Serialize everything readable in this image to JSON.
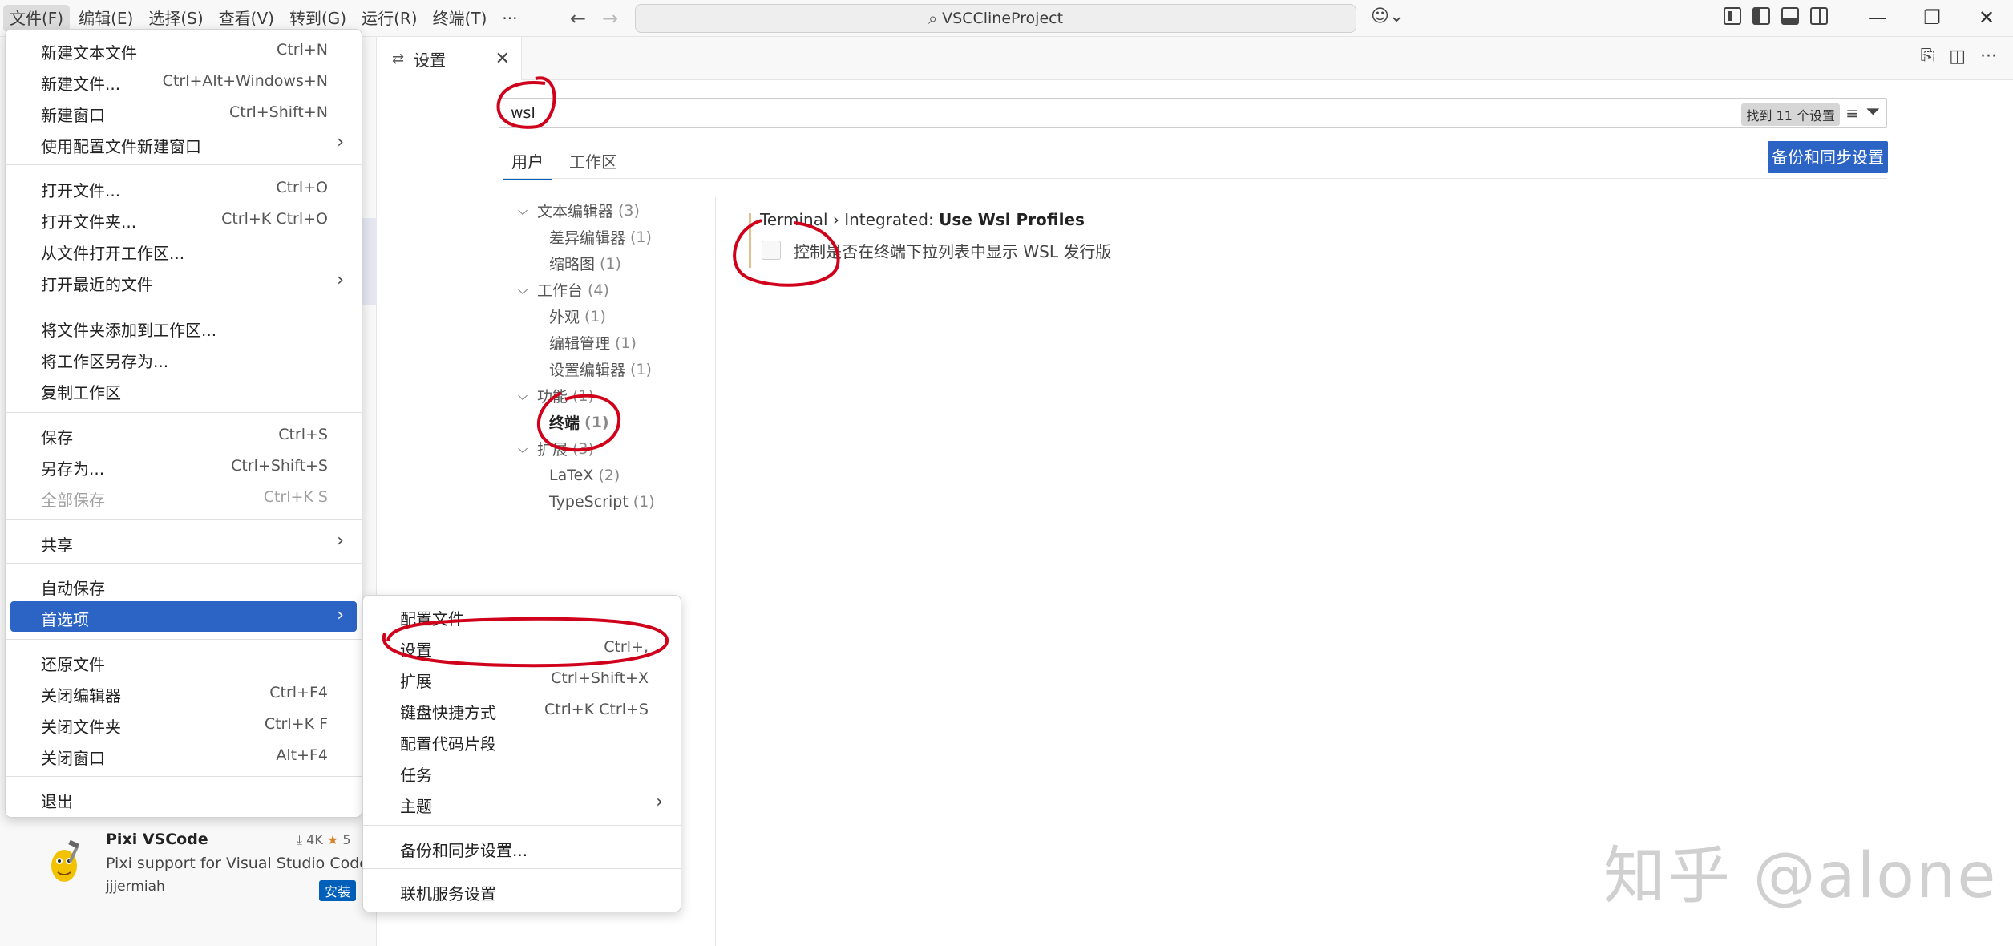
{
  "menubar": {
    "items": [
      "文件(F)",
      "编辑(E)",
      "选择(S)",
      "查看(V)",
      "转到(G)",
      "运行(R)",
      "终端(T)",
      "···"
    ]
  },
  "command_center": {
    "title": "VSCClineProject"
  },
  "editor_tab": {
    "label": "设置"
  },
  "settings": {
    "search_value": "wsl",
    "found_count": "找到 11 个设置",
    "scope_tabs": [
      "用户",
      "工作区"
    ],
    "sync_button": "备份和同步设置",
    "toc": [
      {
        "label": "文本编辑器",
        "count": "(3)"
      },
      {
        "label": "差异编辑器",
        "count": "(1)"
      },
      {
        "label": "缩略图",
        "count": "(1)"
      },
      {
        "label": "工作台",
        "count": "(4)"
      },
      {
        "label": "外观",
        "count": "(1)"
      },
      {
        "label": "编辑管理",
        "count": "(1)"
      },
      {
        "label": "设置编辑器",
        "count": "(1)"
      },
      {
        "label": "功能",
        "count": "(1)"
      },
      {
        "label": "终端",
        "count": "(1)"
      },
      {
        "label": "扩展",
        "count": "(3)"
      },
      {
        "label": "LaTeX",
        "count": "(2)"
      },
      {
        "label": "TypeScript",
        "count": "(1)"
      }
    ],
    "setting_item": {
      "prefix": "Terminal › Integrated: ",
      "name": "Use Wsl Profiles",
      "description": "控制是否在终端下拉列表中显示 WSL 发行版"
    }
  },
  "file_menu": {
    "items": [
      {
        "label": "新建文本文件",
        "shortcut": "Ctrl+N"
      },
      {
        "label": "新建文件...",
        "shortcut": "Ctrl+Alt+Windows+N"
      },
      {
        "label": "新建窗口",
        "shortcut": "Ctrl+Shift+N"
      },
      {
        "label": "使用配置文件新建窗口",
        "shortcut": ""
      },
      {
        "label": "打开文件...",
        "shortcut": "Ctrl+O"
      },
      {
        "label": "打开文件夹...",
        "shortcut": "Ctrl+K Ctrl+O"
      },
      {
        "label": "从文件打开工作区...",
        "shortcut": ""
      },
      {
        "label": "打开最近的文件",
        "shortcut": ""
      },
      {
        "label": "将文件夹添加到工作区...",
        "shortcut": ""
      },
      {
        "label": "将工作区另存为...",
        "shortcut": ""
      },
      {
        "label": "复制工作区",
        "shortcut": ""
      },
      {
        "label": "保存",
        "shortcut": "Ctrl+S"
      },
      {
        "label": "另存为...",
        "shortcut": "Ctrl+Shift+S"
      },
      {
        "label": "全部保存",
        "shortcut": "Ctrl+K S"
      },
      {
        "label": "共享",
        "shortcut": ""
      },
      {
        "label": "自动保存",
        "shortcut": ""
      },
      {
        "label": "首选项",
        "shortcut": ""
      },
      {
        "label": "还原文件",
        "shortcut": ""
      },
      {
        "label": "关闭编辑器",
        "shortcut": "Ctrl+F4"
      },
      {
        "label": "关闭文件夹",
        "shortcut": "Ctrl+K F"
      },
      {
        "label": "关闭窗口",
        "shortcut": "Alt+F4"
      },
      {
        "label": "退出",
        "shortcut": ""
      }
    ]
  },
  "preferences_menu": {
    "items": [
      {
        "label": "配置文件",
        "shortcut": ""
      },
      {
        "label": "设置",
        "shortcut": "Ctrl+,"
      },
      {
        "label": "扩展",
        "shortcut": "Ctrl+Shift+X"
      },
      {
        "label": "键盘快捷方式",
        "shortcut": "Ctrl+K Ctrl+S"
      },
      {
        "label": "配置代码片段",
        "shortcut": ""
      },
      {
        "label": "任务",
        "shortcut": ""
      },
      {
        "label": "主题",
        "shortcut": ""
      },
      {
        "label": "备份和同步设置...",
        "shortcut": ""
      },
      {
        "label": "联机服务设置",
        "shortcut": ""
      }
    ]
  },
  "extension": {
    "name": "Pixi VSCode",
    "downloads": "4K",
    "rating": "5",
    "description": "Pixi support for Visual Studio Code ...",
    "author": "jjjermiah",
    "install_label": "安装"
  },
  "watermark": "知乎 @alone",
  "colors": {
    "accent": "#2c64c6",
    "annotation": "#d0021b",
    "modified_bar": "#e2c08d"
  }
}
